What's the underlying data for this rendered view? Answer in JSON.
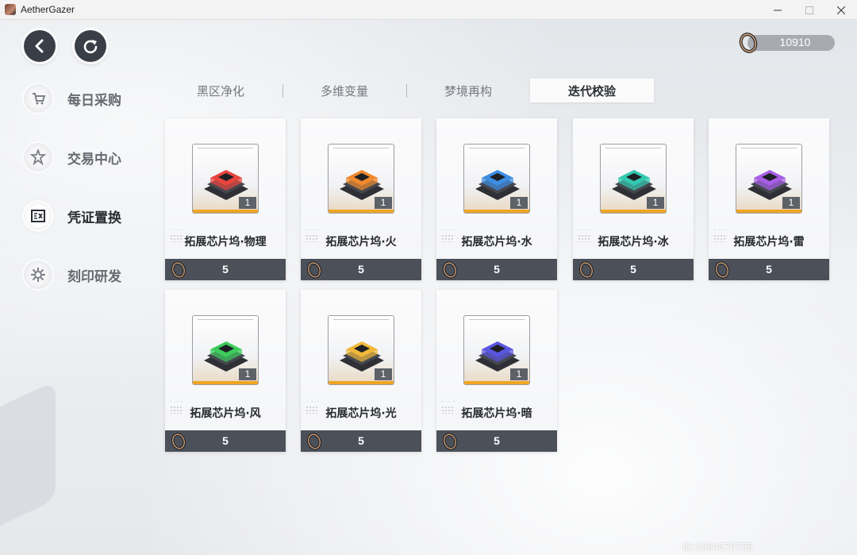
{
  "window": {
    "title": "AetherGazer"
  },
  "currency": {
    "amount": "10910",
    "icon": "ring-icon"
  },
  "sidebar": {
    "items": [
      {
        "label": "每日采购",
        "icon": "cart-icon",
        "active": false
      },
      {
        "label": "交易中心",
        "icon": "star-badge-icon",
        "active": false
      },
      {
        "label": "凭证置换",
        "icon": "voucher-icon",
        "active": true
      },
      {
        "label": "刻印研发",
        "icon": "cog-icon",
        "active": false
      }
    ]
  },
  "tabs": [
    {
      "label": "黑区净化",
      "active": false
    },
    {
      "label": "多维变量",
      "active": false
    },
    {
      "label": "梦境再构",
      "active": false
    },
    {
      "label": "迭代校验",
      "active": true
    }
  ],
  "items": [
    {
      "name": "拓展芯片坞·物理",
      "qty": "1",
      "price": "5",
      "color": "#e8443d"
    },
    {
      "name": "拓展芯片坞·火",
      "qty": "1",
      "price": "5",
      "color": "#f08a2c"
    },
    {
      "name": "拓展芯片坞·水",
      "qty": "1",
      "price": "5",
      "color": "#3d8de3"
    },
    {
      "name": "拓展芯片坞·冰",
      "qty": "1",
      "price": "5",
      "color": "#33c8b0"
    },
    {
      "name": "拓展芯片坞·雷",
      "qty": "1",
      "price": "5",
      "color": "#a85ee6"
    },
    {
      "name": "拓展芯片坞·风",
      "qty": "1",
      "price": "5",
      "color": "#3ccc5c"
    },
    {
      "name": "拓展芯片坞·光",
      "qty": "1",
      "price": "5",
      "color": "#f0b83a"
    },
    {
      "name": "拓展芯片坞·暗",
      "qty": "1",
      "price": "5",
      "color": "#5a56e0"
    }
  ],
  "watermark": "ID:1084679785"
}
